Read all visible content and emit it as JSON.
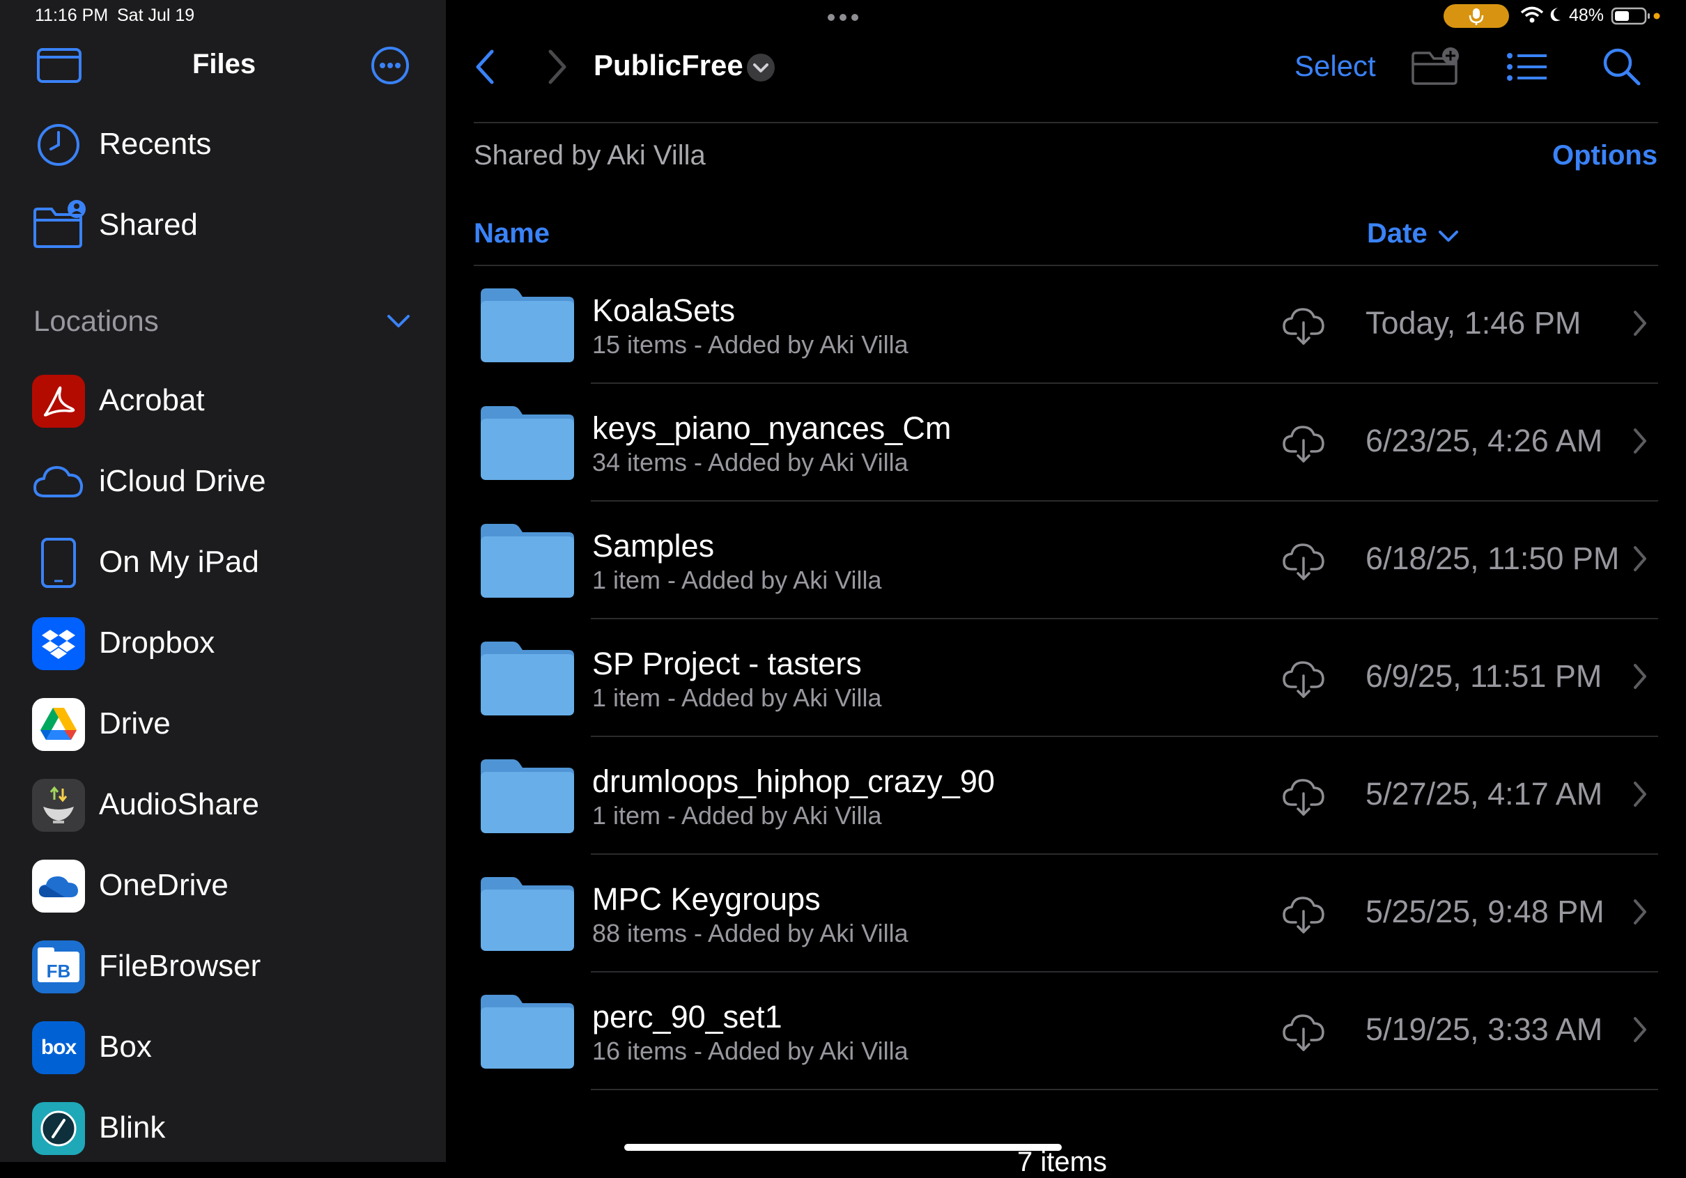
{
  "status_bar": {
    "time": "11:16 PM",
    "date": "Sat Jul 19",
    "battery": "48%",
    "mic_icon": "microphone-icon",
    "wifi_icon": "wifi-icon",
    "moon_icon": "moon-icon",
    "battery_icon": "battery-icon"
  },
  "sidebar": {
    "title": "Files",
    "recents": "Recents",
    "shared": "Shared",
    "locations_header": "Locations",
    "locations": [
      {
        "label": "Acrobat",
        "icon": "acrobat-icon",
        "color": "#b30b00"
      },
      {
        "label": "iCloud Drive",
        "icon": "icloud-icon",
        "color": "#3a82f7"
      },
      {
        "label": "On My iPad",
        "icon": "ipad-icon",
        "color": "#3a82f7"
      },
      {
        "label": "Dropbox",
        "icon": "dropbox-icon",
        "color": "#0061fe"
      },
      {
        "label": "Drive",
        "icon": "google-drive-icon",
        "color": "#ffffff"
      },
      {
        "label": "AudioShare",
        "icon": "audioshare-icon",
        "color": "#3a3a3c"
      },
      {
        "label": "OneDrive",
        "icon": "onedrive-icon",
        "color": "#ffffff"
      },
      {
        "label": "FileBrowser",
        "icon": "filebrowser-icon",
        "color": "#1b6fd1"
      },
      {
        "label": "Box",
        "icon": "box-icon",
        "color": "#0061d5"
      },
      {
        "label": "Blink",
        "icon": "blink-icon",
        "color": "#1fa8b8"
      }
    ],
    "filebrowser_text": "FB",
    "box_text": "box"
  },
  "toolbar": {
    "folder_title": "PublicFree",
    "select_label": "Select"
  },
  "header": {
    "shared_by": "Shared by Aki Villa",
    "options_label": "Options",
    "col_name": "Name",
    "col_date": "Date"
  },
  "files": [
    {
      "name": "KoalaSets",
      "subtitle": "15 items - Added by Aki Villa",
      "date": "Today, 1:46 PM"
    },
    {
      "name": "keys_piano_nyances_Cm",
      "subtitle": "34 items - Added by Aki Villa",
      "date": "6/23/25, 4:26 AM"
    },
    {
      "name": "Samples",
      "subtitle": "1 item - Added by Aki Villa",
      "date": "6/18/25, 11:50 PM"
    },
    {
      "name": "SP Project - tasters",
      "subtitle": "1 item - Added by Aki Villa",
      "date": "6/9/25, 11:51 PM"
    },
    {
      "name": "drumloops_hiphop_crazy_90",
      "subtitle": "1 item - Added by Aki Villa",
      "date": "5/27/25, 4:17 AM"
    },
    {
      "name": "MPC Keygroups",
      "subtitle": "88 items - Added by Aki Villa",
      "date": "5/25/25, 9:48 PM"
    },
    {
      "name": "perc_90_set1",
      "subtitle": "16 items - Added by Aki Villa",
      "date": "5/19/25, 3:33 AM"
    }
  ],
  "footer": {
    "item_count": "7 items"
  },
  "colors": {
    "accent": "#3a82f7",
    "folder": "#5fa6e8",
    "sidebar_bg": "#1c1c1e"
  }
}
